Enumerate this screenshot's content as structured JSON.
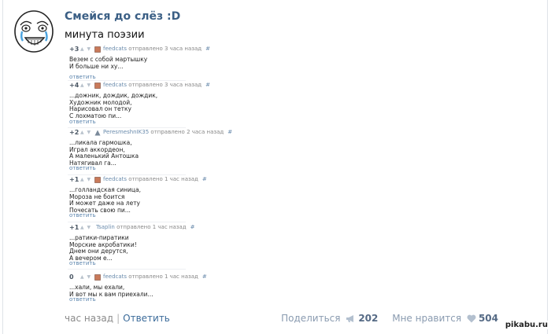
{
  "post": {
    "title": "Смейся до слёз :D",
    "text": "минута поэзии"
  },
  "comments": [
    {
      "score": "+3",
      "user": "feedcats",
      "time": "отправлено 3 часа назад",
      "hash": "#",
      "body": "Везем с собой мартышку\nИ больше ни ху...",
      "reply": "ответить"
    },
    {
      "score": "+4",
      "user": "feedcats",
      "time": "отправлено 3 часа назад",
      "hash": "#",
      "body": "...дожник, дождик, дождик,\nХудожник молодой,\nНарисовал он тетку\nС лохматою пи...",
      "reply": "ответить"
    },
    {
      "score": "+2",
      "user": "PeresmeshnIK35",
      "time": "отправлено 2 часа назад",
      "hash": "#",
      "body": "...ликала гармошка,\nИграл аккордеон,\nА маленький Антошка\nНатягивал га...",
      "reply": "ответить"
    },
    {
      "score": "+1",
      "user": "feedcats",
      "time": "отправлено 1 час назад",
      "hash": "#",
      "body": "...голландская синица,\nМороза не боится\nИ может даже на лету\nПочесать свою пи...",
      "reply": "ответить"
    },
    {
      "score": "+1",
      "user": "Tsaplin",
      "time": "отправлено 1 час назад",
      "hash": "#",
      "body": "...ратики-пиратики\nМорские акробатики!\nДнем они дерутся,\nА вечером е...",
      "reply": "ответить"
    },
    {
      "score": "0",
      "user": "feedcats",
      "time": "отправлено 1 час назад",
      "hash": "#",
      "body": "...хали, мы ехали,\nИ вот мы к вам приехали...",
      "reply": "ответить"
    }
  ],
  "footer": {
    "time": "час назад",
    "pipe": "|",
    "reply": "Ответить",
    "share_label": "Поделиться",
    "share_count": "202",
    "like_label": "Мне нравится",
    "like_count": "504"
  },
  "watermark": "pikabu.ru",
  "colors": {
    "title": "#3b5f85",
    "link": "#5b84ad",
    "stat": "#8a9bb0"
  }
}
